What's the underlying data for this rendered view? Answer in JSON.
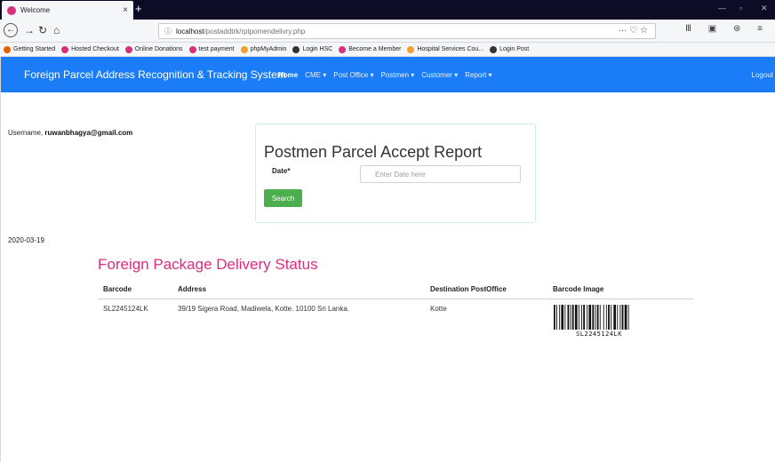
{
  "browser": {
    "tab_title": "Welcome",
    "tab_close": "×",
    "new_tab": "+",
    "url_host": "localhost",
    "url_path": "/postaddtrk/rptpomendelivry.php",
    "url_actions": "··· ♡ ☆",
    "toolbar_right": "Ⅲ ▣ ⊛ ≡",
    "bookmarks": [
      {
        "label": "Getting Started",
        "color": "#e66000"
      },
      {
        "label": "Hosted Checkout",
        "color": "#d6307a"
      },
      {
        "label": "Online Donations",
        "color": "#d6307a"
      },
      {
        "label": "test payment",
        "color": "#d6307a"
      },
      {
        "label": "phpMyAdmin",
        "color": "#f0a030"
      },
      {
        "label": "Login HSC",
        "color": "#333333"
      },
      {
        "label": "Become a Member",
        "color": "#d6307a"
      },
      {
        "label": "Hospital Services Cou...",
        "color": "#f0a030"
      },
      {
        "label": "Login Post",
        "color": "#333333"
      }
    ]
  },
  "app": {
    "brand": "Foreign Parcel Address Recognition & Tracking System",
    "menu": [
      "Home",
      "CME ▾",
      "Post Office ▾",
      "Postmen ▾",
      "Customer ▾",
      "Report ▾"
    ],
    "logout": "Logout",
    "nav_color": "#1a7cf7"
  },
  "user": {
    "prefix": "Username, ",
    "email": "ruwanbhagya@gmail.com"
  },
  "form": {
    "title": "Postmen Parcel Accept Report",
    "date_label": "Date*",
    "date_placeholder": "Enter Date here",
    "search_label": "Search"
  },
  "report": {
    "date": "2020-03-19",
    "title": "Foreign Package Delivery Status",
    "columns": [
      "Barcode",
      "Address",
      "Destination PostOffice",
      "Barcode Image"
    ],
    "rows": [
      {
        "barcode": "SL2245124LK",
        "address": "39/19 Sigera Road, Madiwela, Kotte. 10100 Sri Lanka.",
        "post_office": "Kotte",
        "barcode_text": "SL2245124LK"
      }
    ]
  },
  "colors": {
    "accent_pink": "#e02a7e",
    "button_green": "#4cae4c"
  }
}
